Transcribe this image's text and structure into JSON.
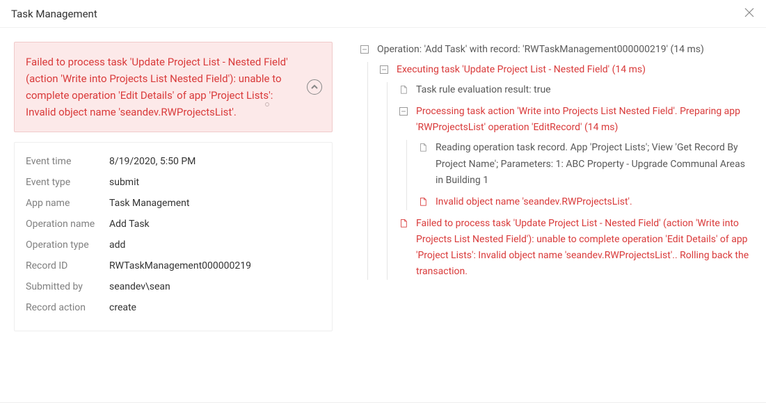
{
  "dialog": {
    "title": "Task Management"
  },
  "error": {
    "message": "Failed to process task 'Update Project List - Nested Field' (action 'Write into Projects List Nested Field'): unable to complete operation 'Edit Details' of app 'Project Lists': Invalid object name 'seandev.RWProjectsList'."
  },
  "details": {
    "event_time": {
      "label": "Event time",
      "value": "8/19/2020, 5:50 PM"
    },
    "event_type": {
      "label": "Event type",
      "value": "submit"
    },
    "app_name": {
      "label": "App name",
      "value": "Task Management"
    },
    "operation_name": {
      "label": "Operation name",
      "value": "Add Task"
    },
    "operation_type": {
      "label": "Operation type",
      "value": "add"
    },
    "record_id": {
      "label": "Record ID",
      "value": "RWTaskManagement000000219"
    },
    "submitted_by": {
      "label": "Submitted by",
      "value": "seandev\\sean"
    },
    "record_action": {
      "label": "Record action",
      "value": "create"
    }
  },
  "tree": {
    "root": "Operation: 'Add Task' with record: 'RWTaskManagement000000219' (14 ms)",
    "n1": "Executing task 'Update Project List - Nested Field' (14 ms)",
    "n1a": "Task rule evaluation result: true",
    "n1b": "Processing task action 'Write into Projects List Nested Field'. Preparing app 'RWProjectsList' operation 'EditRecord' (14 ms)",
    "n1b1": "Reading operation task record. App 'Project Lists'; View 'Get Record By Project Name'; Parameters: 1: ABC Property - Upgrade Communal Areas in Building 1",
    "n1b2": "Invalid object name 'seandev.RWProjectsList'.",
    "n1c": "Failed to process task 'Update Project List - Nested Field' (action 'Write into Projects List Nested Field'): unable to complete operation 'Edit Details' of app 'Project Lists': Invalid object name 'seandev.RWProjectsList'.. Rolling back the transaction."
  }
}
